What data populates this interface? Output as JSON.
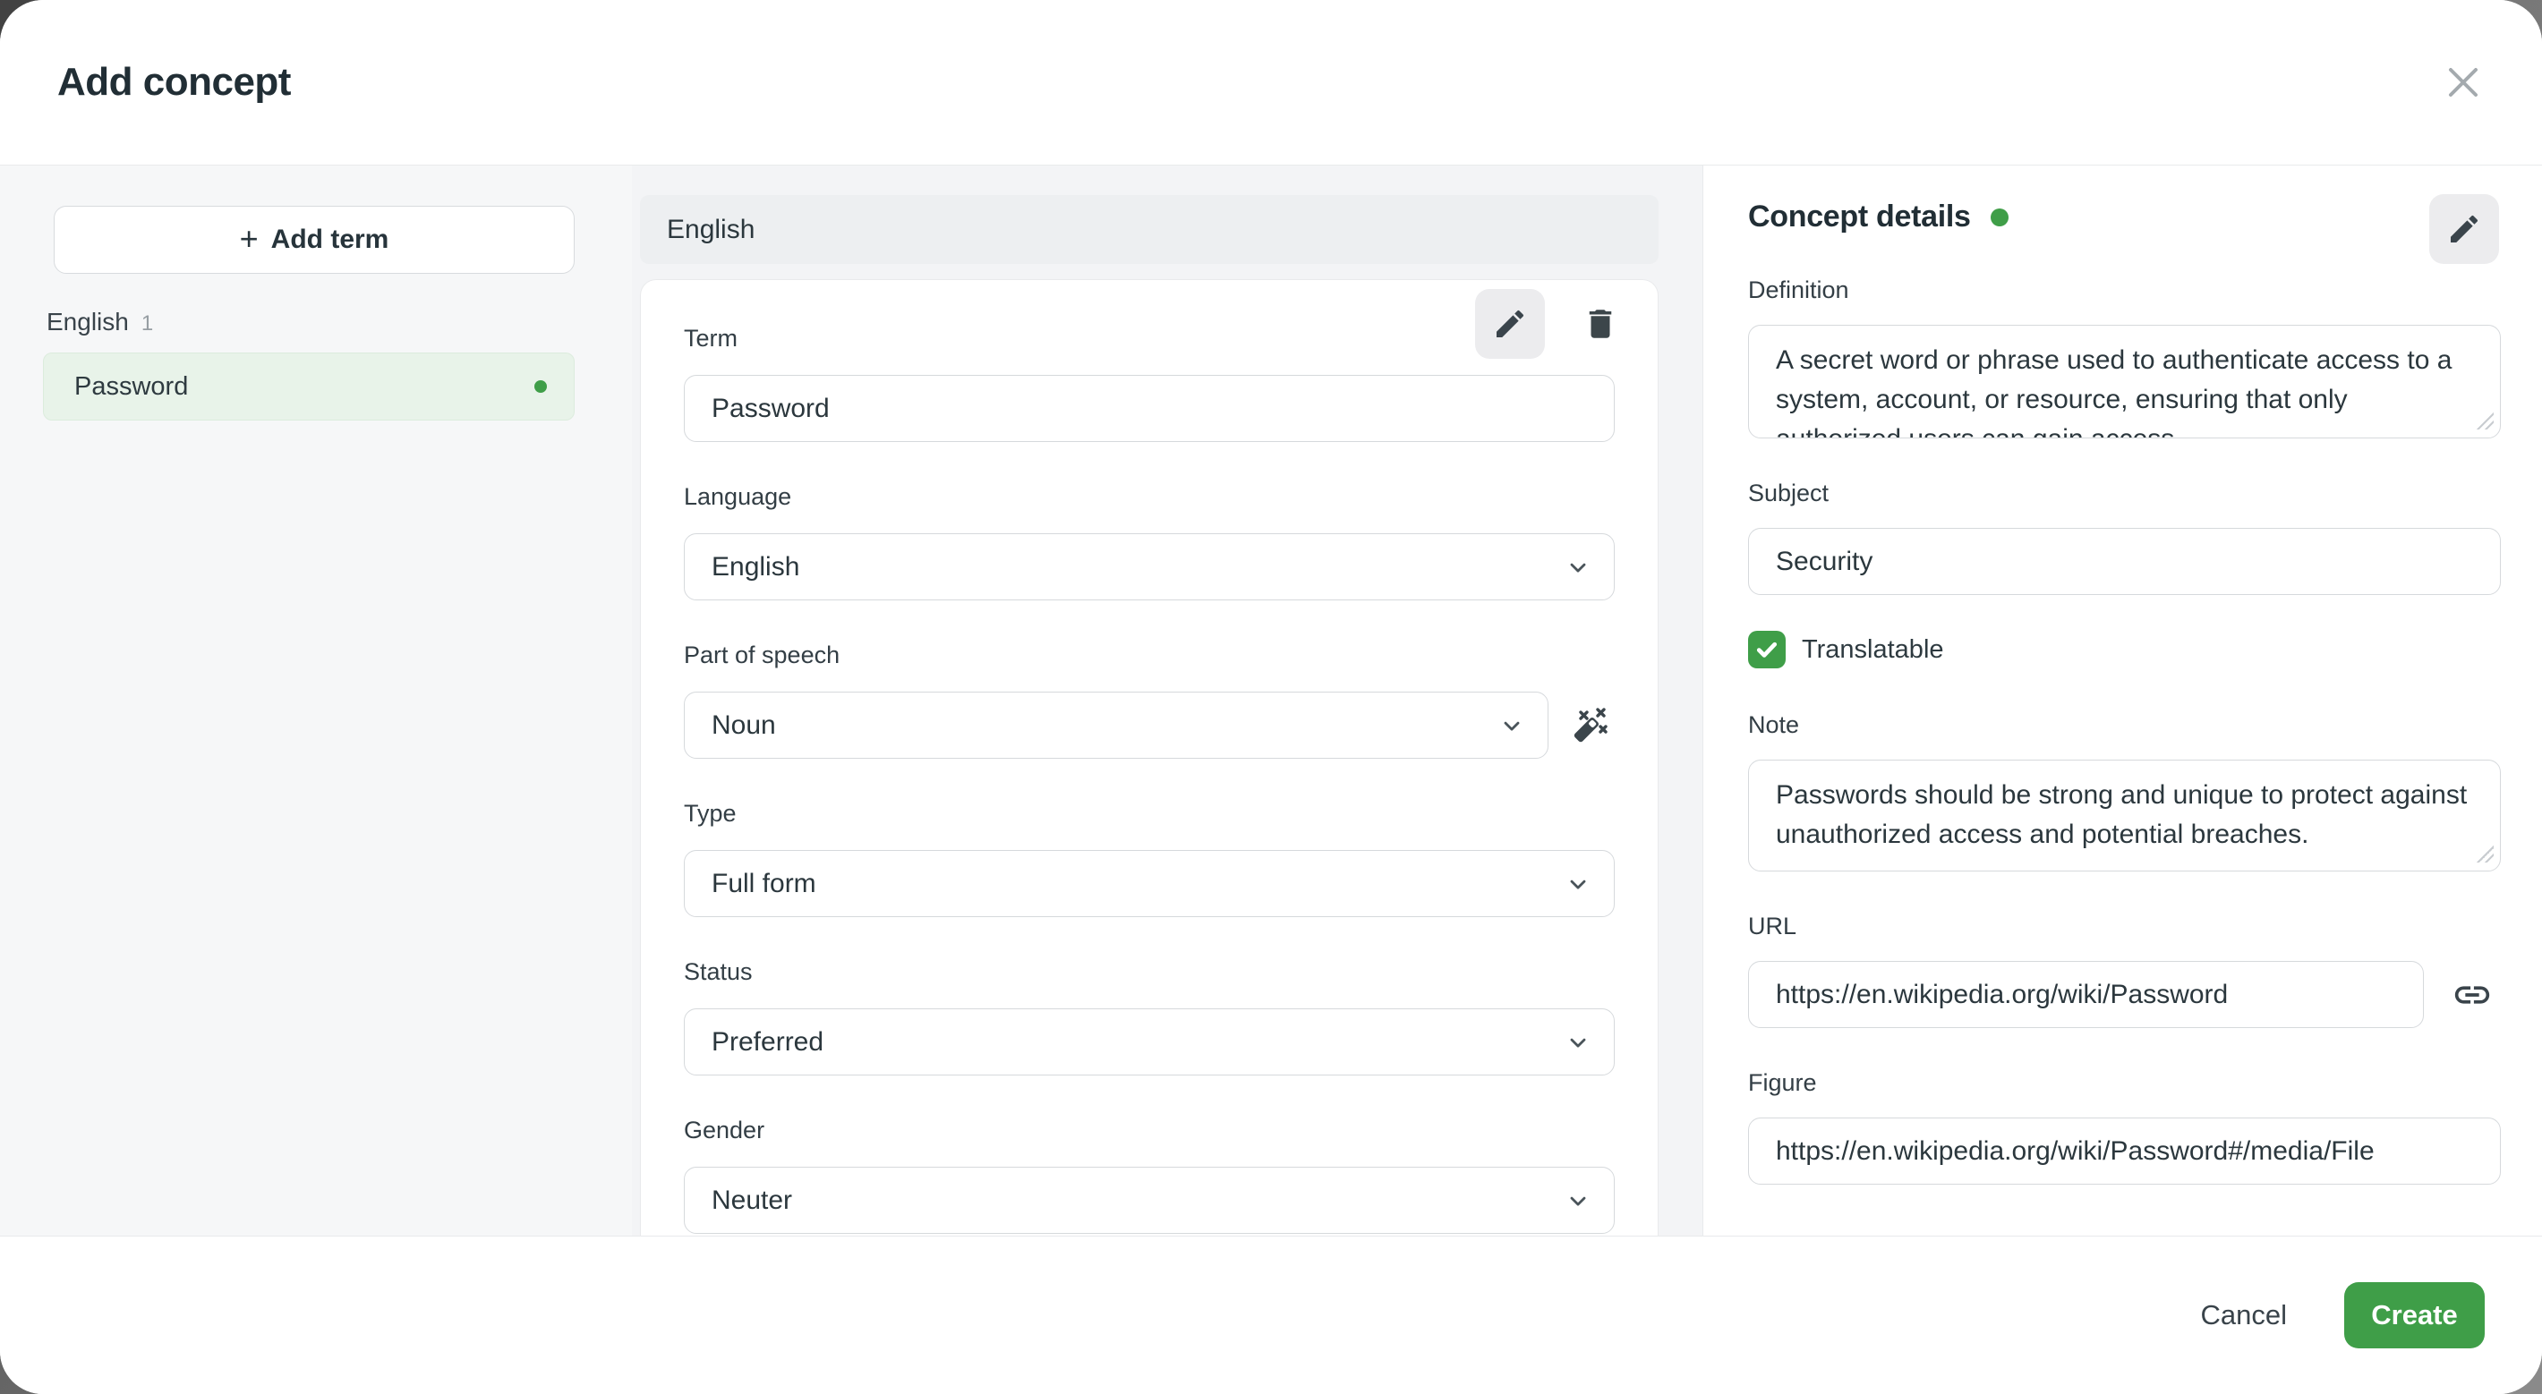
{
  "header": {
    "title": "Add concept"
  },
  "sidebar": {
    "add_term": {
      "icon_glyph": "+",
      "label": "Add term"
    },
    "group": {
      "label": "English",
      "count": "1"
    },
    "terms": [
      {
        "label": "Password"
      }
    ]
  },
  "term_editor": {
    "section_title": "English",
    "fields": {
      "term": {
        "label": "Term",
        "value": "Password"
      },
      "language": {
        "label": "Language",
        "value": "English"
      },
      "part_of_speech": {
        "label": "Part of speech",
        "value": "Noun"
      },
      "type": {
        "label": "Type",
        "value": "Full form"
      },
      "status": {
        "label": "Status",
        "value": "Preferred"
      },
      "gender": {
        "label": "Gender",
        "value": "Neuter"
      }
    }
  },
  "concept_details": {
    "title": "Concept details",
    "definition": {
      "label": "Definition",
      "value": "A secret word or phrase used to authenticate access to a system, account, or resource, ensuring that only authorized users can gain access."
    },
    "subject": {
      "label": "Subject",
      "value": "Security"
    },
    "translatable": {
      "label": "Translatable",
      "checked": true
    },
    "note": {
      "label": "Note",
      "value": "Passwords should be strong and unique to protect against unauthorized access and potential breaches."
    },
    "url": {
      "label": "URL",
      "value": "https://en.wikipedia.org/wiki/Password"
    },
    "figure": {
      "label": "Figure",
      "value": "https://en.wikipedia.org/wiki/Password#/media/File"
    }
  },
  "footer": {
    "cancel_label": "Cancel",
    "create_label": "Create"
  },
  "colors": {
    "accent_green": "#3f9e48",
    "active_term_bg": "#e8f3e9",
    "panel_gray": "#f3f4f6",
    "text_dark": "#212e35"
  }
}
